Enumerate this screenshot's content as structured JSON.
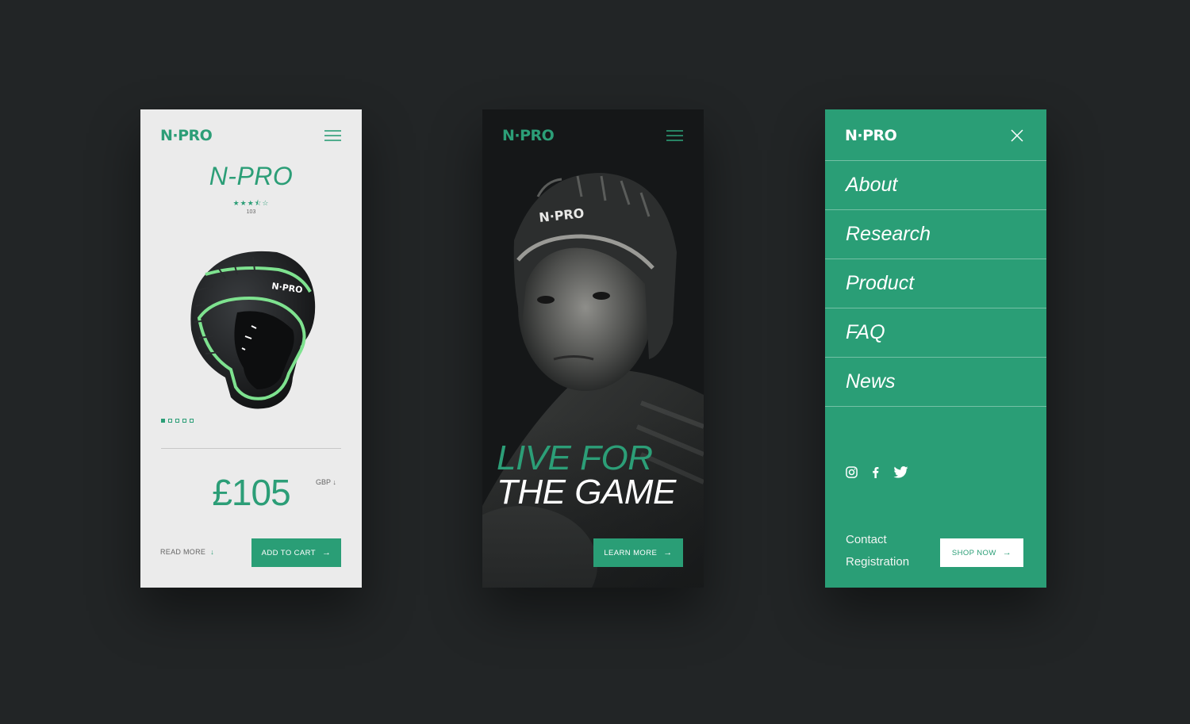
{
  "brand": {
    "logo": "N·PRO",
    "accent": "#2a9e76",
    "light_green": "#7ee28f",
    "bg": "#222526"
  },
  "product_screen": {
    "menu_icon": "hamburger-icon",
    "title": "N-PRO",
    "rating": {
      "stars": "★★★⯪☆",
      "value": 3.5,
      "max": 5
    },
    "review_count": "103",
    "carousel": {
      "total": 5,
      "active": 1
    },
    "price": "£105",
    "currency": "GBP ↓",
    "read_more": "READ MORE",
    "read_more_arrow": "↓",
    "add_to_cart": "ADD TO CART",
    "arrow": "→"
  },
  "hero_screen": {
    "menu_icon": "hamburger-icon",
    "headline_line1": "LIVE FOR",
    "headline_line2": "THE GAME",
    "learn_more": "LEARN MORE",
    "arrow": "→"
  },
  "menu_screen": {
    "close_icon": "close-icon",
    "items": [
      {
        "label": "About"
      },
      {
        "label": "Research"
      },
      {
        "label": "Product"
      },
      {
        "label": "FAQ"
      },
      {
        "label": "News"
      }
    ],
    "social": [
      "instagram-icon",
      "facebook-icon",
      "twitter-icon"
    ],
    "contact": "Contact",
    "registration": "Registration",
    "shop_now": "SHOP NOW",
    "arrow": "→"
  }
}
